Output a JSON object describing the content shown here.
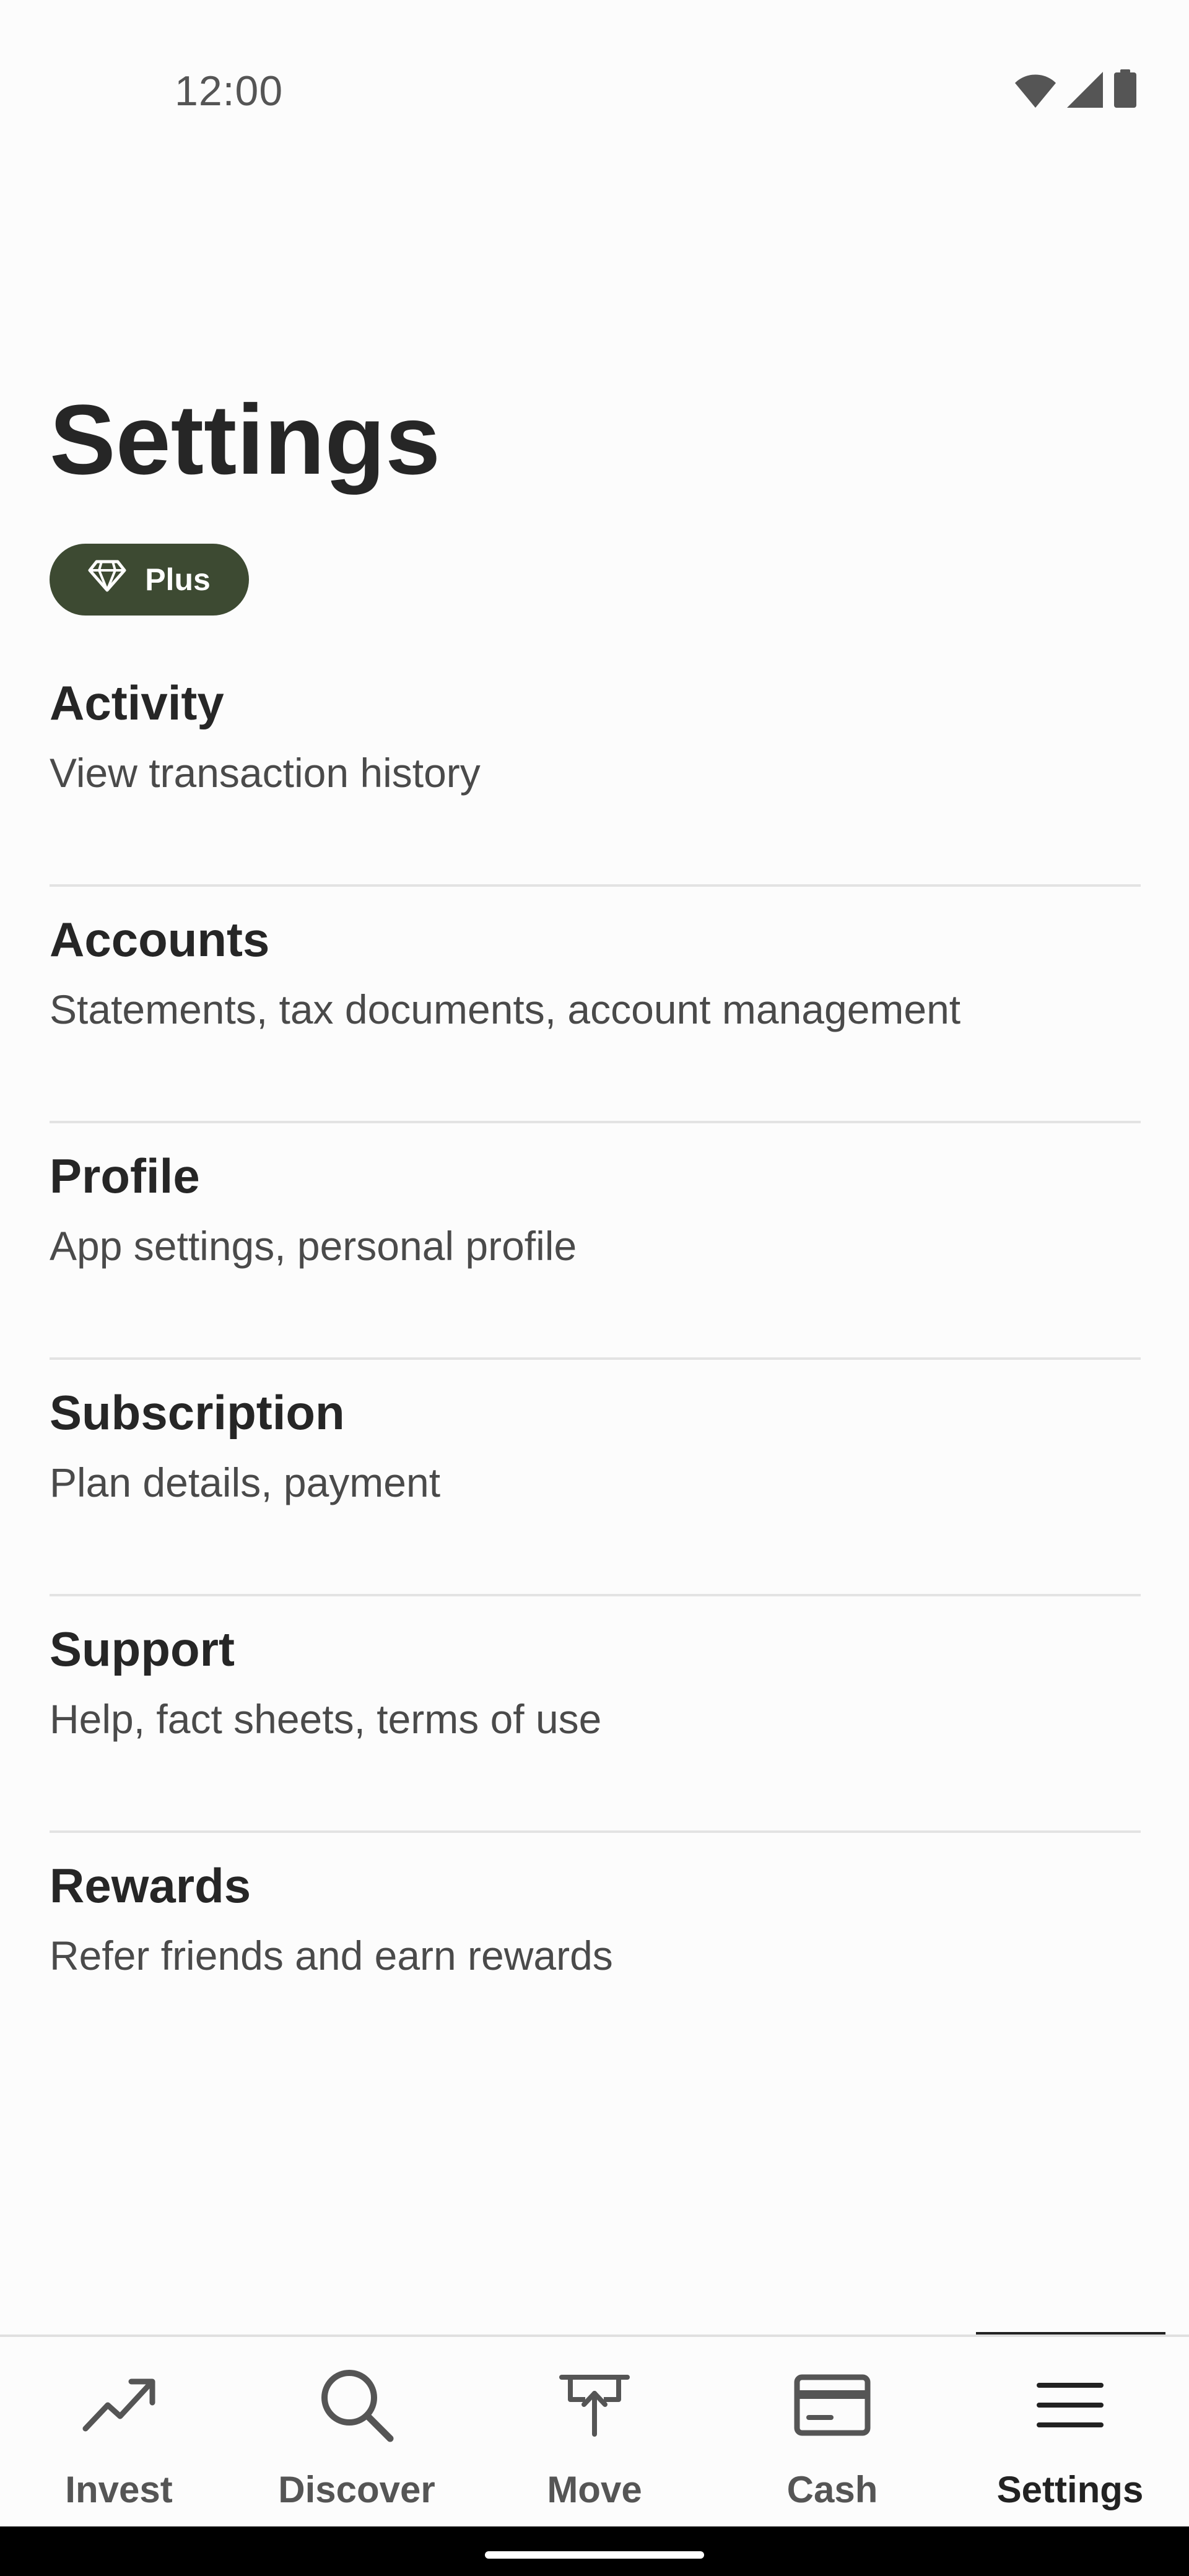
{
  "status_bar": {
    "time": "12:00",
    "icons": [
      "wifi-icon",
      "signal-icon",
      "battery-icon"
    ]
  },
  "page": {
    "title": "Settings",
    "badge_label": "Plus",
    "badge_icon": "diamond-icon"
  },
  "menu": [
    {
      "title": "Activity",
      "subtitle": "View transaction history"
    },
    {
      "title": "Accounts",
      "subtitle": "Statements, tax documents, account management"
    },
    {
      "title": "Profile",
      "subtitle": "App settings, personal profile"
    },
    {
      "title": "Subscription",
      "subtitle": "Plan details, payment"
    },
    {
      "title": "Support",
      "subtitle": "Help, fact sheets, terms of use"
    },
    {
      "title": "Rewards",
      "subtitle": "Refer friends and earn rewards"
    }
  ],
  "bottom_nav": [
    {
      "label": "Invest",
      "icon": "trending-up-icon"
    },
    {
      "label": "Discover",
      "icon": "search-icon"
    },
    {
      "label": "Move",
      "icon": "transfer-icon"
    },
    {
      "label": "Cash",
      "icon": "card-icon"
    },
    {
      "label": "Settings",
      "icon": "menu-icon",
      "active": true
    }
  ],
  "colors": {
    "badge_bg": "#3d4a32",
    "text_primary": "#262626",
    "text_secondary": "#4a4a4a",
    "divider": "#e3e3e3"
  }
}
